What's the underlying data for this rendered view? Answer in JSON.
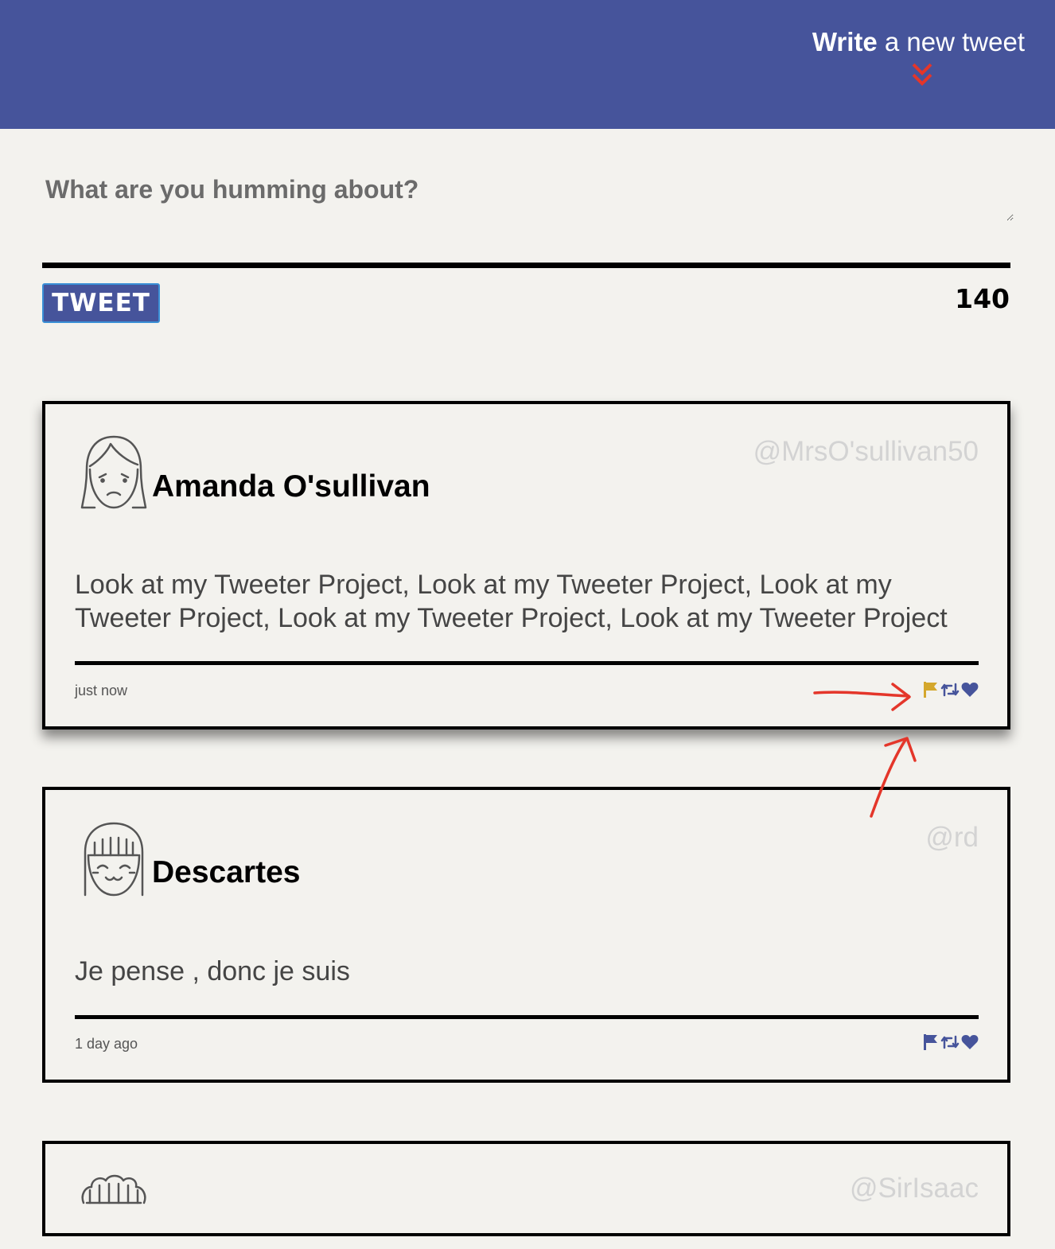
{
  "header": {
    "compose_bold": "Write",
    "compose_rest": " a new tweet",
    "chevron_icon": "double-chevron-down-icon",
    "background": "#46549b",
    "accent": "#e4362a"
  },
  "composer": {
    "placeholder": "What are you humming about?",
    "button_label": "TWEET",
    "counter": "140"
  },
  "tweets": [
    {
      "name": "Amanda O'sullivan",
      "handle": "@MrsO'sullivan50",
      "content": "Look at my Tweeter Project, Look at my Tweeter Project, Look at my Tweeter Project, Look at my Tweeter Project, Look at my Tweeter Project",
      "time": "just now",
      "flag_color": "#d4a72c",
      "hovered": true
    },
    {
      "name": "Descartes",
      "handle": "@rd",
      "content": "Je pense , donc je suis",
      "time": "1 day ago",
      "flag_color": "#46549b",
      "hovered": false
    },
    {
      "name": "",
      "handle": "@SirIsaac",
      "content": "",
      "time": ""
    }
  ],
  "icons": {
    "action_color": "#46549b",
    "actions": [
      "flag-icon",
      "retweet-icon",
      "heart-icon"
    ]
  },
  "annotation": {
    "color": "#e4362a",
    "arrows": 2
  }
}
